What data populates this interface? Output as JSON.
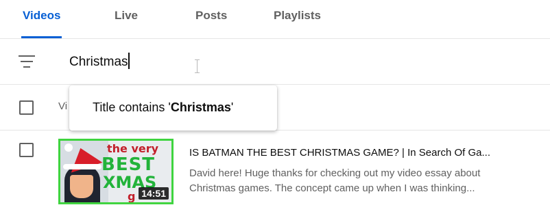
{
  "tabs": [
    {
      "label": "Videos",
      "active": true
    },
    {
      "label": "Live",
      "active": false
    },
    {
      "label": "Posts",
      "active": false
    },
    {
      "label": "Playlists",
      "active": false
    }
  ],
  "filter": {
    "icon": "filter-icon",
    "value": "Christmas"
  },
  "table_header": {
    "video_label": "Vi"
  },
  "suggestion": {
    "prefix": "Title contains '",
    "term": "Christmas",
    "suffix": "'"
  },
  "video": {
    "thumbnail": {
      "text_line1": "the very",
      "text_line2": "BEST",
      "text_line3": "XMAS",
      "text_line4": "g",
      "duration": "14:51"
    },
    "title": "IS BATMAN THE BEST CHRISTMAS GAME? | In Search Of Ga...",
    "description_line1": "David here! Huge thanks for checking out my video essay about",
    "description_line2": "Christmas games. The concept came up when I was thinking..."
  },
  "colors": {
    "accent": "#065fd4",
    "text_secondary": "#606060",
    "thumbnail_border": "#3fd43f"
  }
}
